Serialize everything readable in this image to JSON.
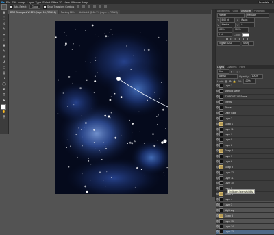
{
  "menu": {
    "items": [
      "Ps",
      "File",
      "Edit",
      "Image",
      "Layer",
      "Type",
      "Select",
      "Filter",
      "3D",
      "View",
      "Window",
      "Help"
    ],
    "workspace": "Essentials"
  },
  "options": {
    "auto_select_label": "Auto-Select:",
    "auto_select_target": "Group",
    "show_transform_label": "Show Transform Controls"
  },
  "tabs": [
    {
      "label": "DSC Coverpaint W 25% (Layer 16, RGB/16)",
      "active": true
    },
    {
      "label": "Painting 16%",
      "active": false
    },
    {
      "label": "Untitled-1 @ 66.7% (Layer 1, RGB/8)",
      "active": false
    }
  ],
  "tools": [
    "move",
    "marquee",
    "lasso",
    "quick-select",
    "crop",
    "eyedropper",
    "healing",
    "brush",
    "clone",
    "history",
    "eraser",
    "gradient",
    "blur",
    "dodge",
    "pen",
    "type",
    "path-select",
    "shape",
    "hand",
    "zoom"
  ],
  "colors": {
    "foreground": "#ffffff",
    "background": "#000000"
  },
  "character_panel": {
    "tabs": [
      "Adjustments",
      "Color",
      "Character",
      "Paragraph"
    ],
    "font_family": "Hoefler",
    "font_style": "Regular",
    "size": "5.00 pt",
    "leading": "(Auto)",
    "kerning": "Metrics",
    "tracking": "0",
    "vscale": "100%",
    "hscale": "100%",
    "baseline": "0 pt",
    "language": "English: USA",
    "antialias": "Sharp"
  },
  "layers_panel": {
    "tabs": [
      "Layers",
      "Channels",
      "Paths"
    ],
    "filter_kind": "Kind",
    "blend_mode": "Normal",
    "opacity_label": "Opacity:",
    "opacity": "100%",
    "lock_label": "Lock:",
    "fill_label": "Fill:",
    "fill": "100%",
    "layers": [
      {
        "name": "Layer 1",
        "group": false,
        "selected": false
      },
      {
        "name": "Stardust scene",
        "group": false,
        "selected": false
      },
      {
        "name": "STARDUST LE Scene",
        "group": false,
        "selected": false
      },
      {
        "name": "Effects",
        "group": false,
        "selected": false
      },
      {
        "name": "Stroke",
        "group": false,
        "selected": false
      },
      {
        "name": "Outer Glow",
        "group": false,
        "selected": false
      },
      {
        "name": "Layer 2",
        "group": false,
        "selected": false
      },
      {
        "name": "Group 1",
        "group": true,
        "selected": false
      },
      {
        "name": "Layer 11",
        "group": false,
        "selected": false
      },
      {
        "name": "Layer 1",
        "group": false,
        "selected": false
      },
      {
        "name": "Layer 9",
        "group": false,
        "selected": false
      },
      {
        "name": "Layer 8",
        "group": false,
        "selected": false
      },
      {
        "name": "Group 2",
        "group": true,
        "selected": false
      },
      {
        "name": "Layer 7",
        "group": false,
        "selected": false
      },
      {
        "name": "Layer 6",
        "group": false,
        "selected": false
      },
      {
        "name": "Group 3",
        "group": true,
        "selected": false
      },
      {
        "name": "Layer 12",
        "group": false,
        "selected": false
      },
      {
        "name": "Layer 11",
        "group": false,
        "selected": false
      },
      {
        "name": "Layer 10",
        "group": false,
        "selected": false
      },
      {
        "name": "Layer 5",
        "group": false,
        "selected": false
      },
      {
        "name": "Group 4",
        "group": true,
        "selected": false
      },
      {
        "name": "Layer 4",
        "group": false,
        "selected": false
      },
      {
        "name": "Layer 3",
        "group": false,
        "selected": false
      },
      {
        "name": "Night sky",
        "group": false,
        "selected": false
      },
      {
        "name": "Group 5",
        "group": true,
        "selected": false
      },
      {
        "name": "Layer 15",
        "group": false,
        "selected": false
      },
      {
        "name": "Layer 14",
        "group": false,
        "selected": false
      },
      {
        "name": "Layer 13",
        "group": false,
        "selected": true
      }
    ]
  },
  "tooltip": "Indicates layer visibility"
}
